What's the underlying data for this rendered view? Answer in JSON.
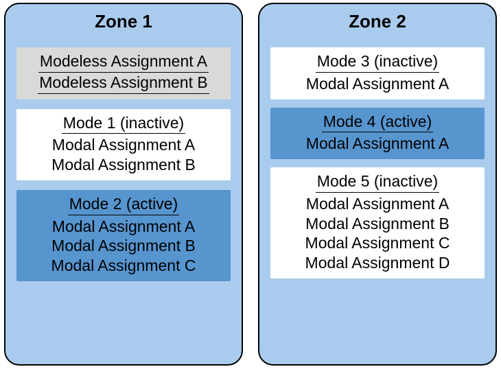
{
  "zones": [
    {
      "title": "Zone 1",
      "blocks": [
        {
          "kind": "modeless",
          "rows": [
            "Modeless Assignment A",
            "Modeless Assignment B"
          ]
        },
        {
          "kind": "inactive",
          "heading": "Mode 1 (inactive)",
          "rows": [
            "Modal Assignment A",
            "Modal Assignment B"
          ]
        },
        {
          "kind": "active",
          "heading": "Mode 2 (active)",
          "rows": [
            "Modal Assignment A",
            "Modal Assignment B",
            "Modal Assignment C"
          ]
        }
      ]
    },
    {
      "title": "Zone 2",
      "blocks": [
        {
          "kind": "inactive",
          "heading": "Mode 3 (inactive)",
          "rows": [
            "Modal Assignment A"
          ]
        },
        {
          "kind": "active",
          "heading": "Mode 4 (active)",
          "rows": [
            "Modal Assignment A"
          ]
        },
        {
          "kind": "inactive",
          "heading": "Mode 5 (inactive)",
          "rows": [
            "Modal Assignment A",
            "Modal Assignment B",
            "Modal Assignment C",
            "Modal Assignment D"
          ]
        }
      ]
    }
  ]
}
